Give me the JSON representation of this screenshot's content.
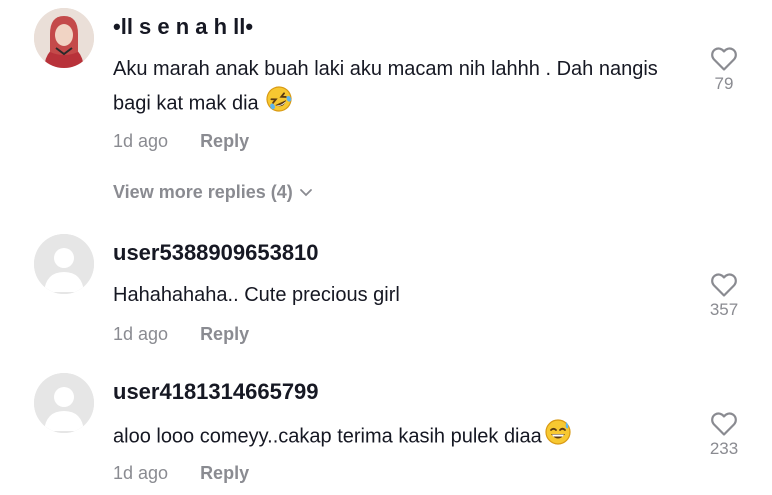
{
  "comments": [
    {
      "username": "•ll s e n a h ll•",
      "text": "Aku marah anak buah laki aku macam nih lahhh . Dah nangis bagi kat mak dia",
      "emoji": "rolling-laughing-emoji",
      "time": "1d ago",
      "reply_label": "Reply",
      "likes": "79"
    },
    {
      "username": "user5388909653810",
      "text": "Hahahahaha.. Cute precious girl",
      "time": "1d ago",
      "reply_label": "Reply",
      "likes": "357"
    },
    {
      "username": "user4181314665799",
      "text": "aloo looo comeyy..cakap terima kasih pulek diaa",
      "emoji": "grinning-sweat-emoji",
      "time": "1d ago",
      "reply_label": "Reply",
      "likes": "233"
    }
  ],
  "view_more_replies": "View more replies (4)",
  "colors": {
    "text": "#161823",
    "muted": "#8a8b91",
    "emoji": "#f7c831"
  }
}
